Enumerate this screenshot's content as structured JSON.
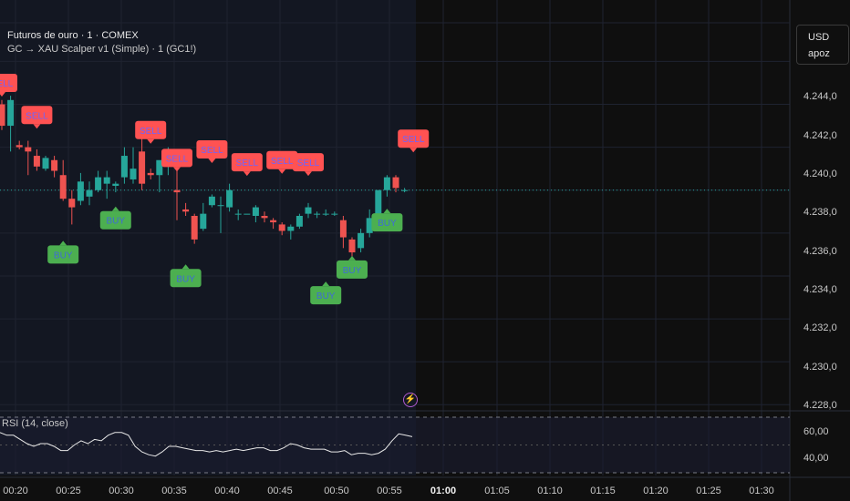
{
  "header": {
    "title": "Futuros de ouro · 1 · COMEX",
    "indicator": "GC → XAU Scalper v1 (Simple) · 1 (GC1!)"
  },
  "price_scale": {
    "currency": "USD",
    "unit": "apoz",
    "labels": [
      "4.244,0",
      "4.242,0",
      "4.240,0",
      "4.238,0",
      "4.236,0",
      "4.234,0",
      "4.232,0",
      "4.230,0",
      "4.228,0"
    ]
  },
  "rsi": {
    "label": "RSI (14, close)",
    "labels": [
      "60,00",
      "40,00"
    ]
  },
  "time_axis": {
    "labels": [
      "00:20",
      "00:25",
      "00:30",
      "00:35",
      "00:40",
      "00:45",
      "00:50",
      "00:55",
      "01:00",
      "01:05",
      "01:10",
      "01:15",
      "01:20",
      "01:25",
      "01:30"
    ],
    "bold": "01:00"
  },
  "signals": {
    "sell_text": "SELL",
    "buy_text": "BUY"
  },
  "colors": {
    "up": "#26a69a",
    "down": "#ef5350",
    "sell_bg": "#ff5252",
    "sell_text": "#6c63ff",
    "buy_bg": "#4caf50",
    "buy_text": "#3f6bd6",
    "session_bg": "#131722",
    "background": "#0f0f0f"
  },
  "chart_data": {
    "type": "candlestick",
    "y_range": [
      4227.8,
      4245.8
    ],
    "last_price": 4238.0,
    "candles": [
      [
        4242.0,
        4242.2,
        4240.8,
        4241.0
      ],
      [
        4241.0,
        4242.4,
        4239.8,
        4242.2
      ],
      [
        4240.1,
        4240.3,
        4239.9,
        4240.0
      ],
      [
        4240.0,
        4240.3,
        4238.7,
        4239.8
      ],
      [
        4239.6,
        4239.9,
        4238.9,
        4239.1
      ],
      [
        4239.0,
        4239.6,
        4238.9,
        4239.5
      ],
      [
        4239.4,
        4239.6,
        4238.6,
        4238.9
      ],
      [
        4238.7,
        4239.4,
        4237.5,
        4237.6
      ],
      [
        4237.6,
        4238.0,
        4236.4,
        4237.2
      ],
      [
        4237.5,
        4238.8,
        4237.3,
        4238.4
      ],
      [
        4237.7,
        4238.4,
        4237.3,
        4238.0
      ],
      [
        4238.0,
        4238.9,
        4237.9,
        4238.6
      ],
      [
        4238.3,
        4238.9,
        4237.6,
        4238.6
      ],
      [
        4238.2,
        4238.4,
        4237.9,
        4238.3
      ],
      [
        4238.6,
        4240.0,
        4238.3,
        4239.6
      ],
      [
        4238.5,
        4240.0,
        4238.3,
        4239.0
      ],
      [
        4239.8,
        4240.6,
        4238.0,
        4238.3
      ],
      [
        4238.8,
        4239.0,
        4238.5,
        4238.7
      ],
      [
        4238.7,
        4239.2,
        4237.9,
        4239.4
      ],
      [
        4239.2,
        4240.0,
        4238.7,
        4239.4
      ],
      [
        4238.0,
        4239.3,
        4236.6,
        4237.9
      ],
      [
        4237.1,
        4237.4,
        4236.8,
        4237.0
      ],
      [
        4236.8,
        4236.9,
        4235.5,
        4235.7
      ],
      [
        4236.2,
        4237.4,
        4236.1,
        4236.9
      ],
      [
        4237.3,
        4237.8,
        4237.2,
        4237.7
      ],
      [
        4237.3,
        4237.7,
        4236.0,
        4237.3
      ],
      [
        4237.2,
        4238.3,
        4237.0,
        4238.0
      ],
      [
        4236.9,
        4237.1,
        4236.6,
        4236.9
      ],
      [
        4236.9,
        4236.9,
        4236.9,
        4236.9
      ],
      [
        4236.8,
        4237.3,
        4236.5,
        4237.2
      ],
      [
        4236.8,
        4237.0,
        4236.5,
        4236.7
      ],
      [
        4236.6,
        4236.7,
        4236.2,
        4236.5
      ],
      [
        4236.4,
        4236.5,
        4235.9,
        4236.1
      ],
      [
        4236.1,
        4236.4,
        4235.7,
        4236.3
      ],
      [
        4236.3,
        4236.9,
        4236.2,
        4236.8
      ],
      [
        4236.9,
        4237.4,
        4236.7,
        4237.2
      ],
      [
        4236.9,
        4237.0,
        4236.7,
        4236.9
      ],
      [
        4236.9,
        4237.1,
        4236.8,
        4236.9
      ],
      [
        4236.9,
        4237.0,
        4236.8,
        4236.9
      ],
      [
        4236.6,
        4236.8,
        4235.3,
        4235.8
      ],
      [
        4235.7,
        4235.8,
        4234.9,
        4235.1
      ],
      [
        4235.3,
        4236.2,
        4235.1,
        4236.0
      ],
      [
        4236.0,
        4237.1,
        4235.8,
        4236.7
      ],
      [
        4236.7,
        4238.0,
        4236.4,
        4238.0
      ],
      [
        4238.0,
        4238.7,
        4237.7,
        4238.6
      ],
      [
        4238.6,
        4238.7,
        4237.9,
        4238.1
      ],
      [
        4238.0,
        4238.1,
        4237.9,
        4238.0
      ]
    ],
    "signals": [
      {
        "type": "sell",
        "bar": 0,
        "price": 4243.0
      },
      {
        "type": "sell",
        "bar": 4,
        "price": 4241.5
      },
      {
        "type": "sell",
        "bar": 17,
        "price": 4240.8
      },
      {
        "type": "sell",
        "bar": 20,
        "price": 4239.5
      },
      {
        "type": "sell",
        "bar": 24,
        "price": 4239.9
      },
      {
        "type": "sell",
        "bar": 28,
        "price": 4239.3
      },
      {
        "type": "sell",
        "bar": 32,
        "price": 4239.4
      },
      {
        "type": "sell",
        "bar": 35,
        "price": 4239.3
      },
      {
        "type": "sell",
        "bar": 47,
        "price": 4240.4
      },
      {
        "type": "buy",
        "bar": 13,
        "price": 4236.6
      },
      {
        "type": "buy",
        "bar": 7,
        "price": 4235.0
      },
      {
        "type": "buy",
        "bar": 21,
        "price": 4233.9
      },
      {
        "type": "buy",
        "bar": 37,
        "price": 4233.1
      },
      {
        "type": "buy",
        "bar": 40,
        "price": 4234.3
      },
      {
        "type": "buy",
        "bar": 44,
        "price": 4236.5
      }
    ],
    "rsi": {
      "range": [
        30,
        70
      ],
      "upper": 70,
      "lower": 30,
      "values": [
        59,
        57,
        57,
        54,
        51,
        49,
        51,
        51,
        49,
        46,
        46,
        50,
        53,
        51,
        54,
        53,
        57,
        59,
        59,
        57,
        49,
        45,
        43,
        42,
        45,
        49,
        49,
        48,
        47,
        46,
        46,
        45,
        46,
        45,
        46,
        47,
        46,
        47,
        48,
        48,
        46,
        46,
        48,
        51,
        50,
        48,
        47,
        47,
        47,
        45,
        45,
        46,
        43,
        44,
        44,
        43,
        44,
        47,
        53,
        58,
        57,
        56
      ],
      "labels_values": [
        60,
        40
      ]
    },
    "time_ticks": [
      "00:20",
      "00:25",
      "00:30",
      "00:35",
      "00:40",
      "00:45",
      "00:50",
      "00:55",
      "01:00",
      "01:05",
      "01:10",
      "01:15",
      "01:20",
      "01:25",
      "01:30"
    ]
  }
}
